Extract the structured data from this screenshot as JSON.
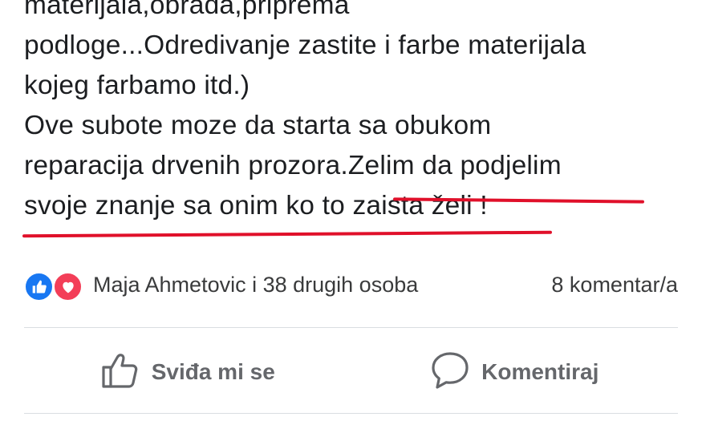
{
  "post": {
    "lines": [
      "materijala,obrada,priprema",
      "podloge...Odredivanje zastite i farbe materijala",
      "kojeg farbamo itd.)",
      "Ove subote moze da starta sa obukom",
      "reparacija drvenih prozora.",
      "Zelim da podjelim",
      "svoje znanje sa onim ko to zaista želi",
      " !"
    ]
  },
  "reactions": {
    "icons": [
      "like-icon",
      "love-icon"
    ],
    "summary": "Maja Ahmetovic i 38 drugih osoba",
    "comments": "8 komentar/a",
    "colors": {
      "like": "#1877f2",
      "love": "#f33e58"
    }
  },
  "actions": {
    "like_label": "Sviđa mi se",
    "comment_label": "Komentiraj"
  },
  "annotation": {
    "underline_color": "#e0102a"
  }
}
